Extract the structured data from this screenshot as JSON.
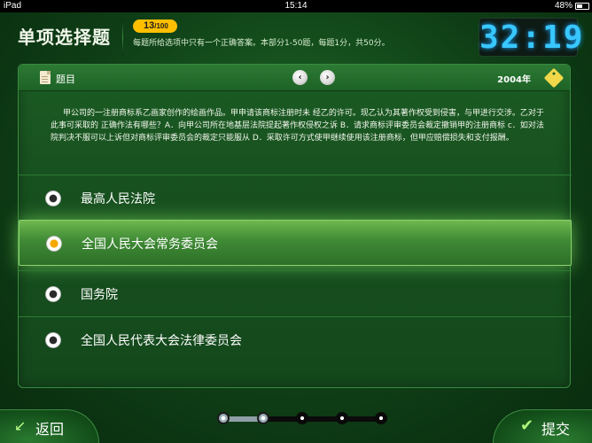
{
  "status_bar": {
    "device": "iPad",
    "time": "15:14",
    "battery": "48%"
  },
  "header": {
    "title": "单项选择题",
    "counter_current": "13",
    "counter_total": "/100",
    "instructions": "每题所给选项中只有一个正确答案。本部分1-50题，每题1分，共50分。",
    "timer": "32:19"
  },
  "question": {
    "header_label": "题目",
    "year": "2004年",
    "text": "甲公司的一注册商标系乙画家创作的绘画作品。甲申请该商标注册时未 经乙的许可。现乙认为其著作权受到侵害，与甲进行交涉。乙对于此事可采取的 正确作法有哪些？A．向甲公司所在地基层法院提起著作权侵权之诉 B．请求商标评审委员会裁定撤销甲的注册商标 c．如对法院判决不服可以上诉但对商标评审委员会的裁定只能服从 D．采取许可方式使甲继续使用该注册商标，但甲应赔偿损失和支付报酬。"
  },
  "options": [
    {
      "label": "最高人民法院",
      "selected": false
    },
    {
      "label": "全国人民大会常务委员会",
      "selected": true
    },
    {
      "label": "国务院",
      "selected": false
    },
    {
      "label": "全国人民代表大会法律委员会",
      "selected": false
    }
  ],
  "footer": {
    "back_label": "返回",
    "submit_label": "提交",
    "progress": {
      "steps": 5,
      "current_step": 2
    }
  },
  "colors": {
    "timer": "#38c7ff",
    "counter_badge": "#ffbf00",
    "selected_radio": "#f5a800",
    "background": "#14481c"
  },
  "icons": [
    "document-icon",
    "chevron-left-icon",
    "chevron-right-icon",
    "tag-icon",
    "back-arrow-icon",
    "check-icon"
  ]
}
